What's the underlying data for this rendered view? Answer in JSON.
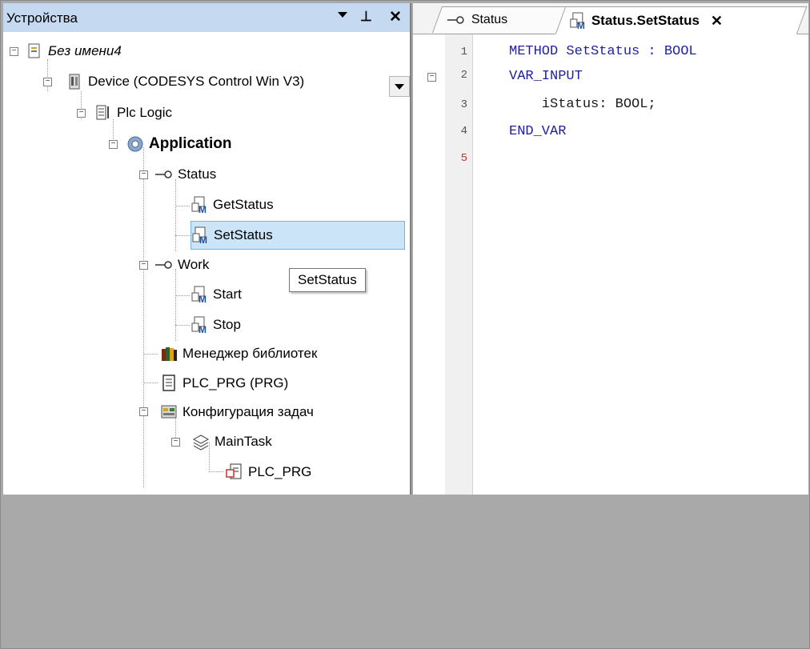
{
  "devices_panel": {
    "title": "Устройства",
    "tree": [
      {
        "label": "Без имени4",
        "italic": true
      },
      {
        "label": "Device (CODESYS Control Win V3)"
      },
      {
        "label": "Plc Logic"
      },
      {
        "label": "Application",
        "bold": true
      },
      {
        "label": "Status"
      },
      {
        "label": "GetStatus"
      },
      {
        "label": "SetStatus",
        "selected": true
      },
      {
        "label": "Work"
      },
      {
        "label": "Start"
      },
      {
        "label": "Stop"
      },
      {
        "label": "Менеджер библиотек"
      },
      {
        "label": "PLC_PRG (PRG)"
      },
      {
        "label": "Конфигурация задач"
      },
      {
        "label": "MainTask"
      },
      {
        "label": "PLC_PRG"
      }
    ],
    "tooltip": "SetStatus"
  },
  "editor": {
    "tabs": [
      {
        "label": "Status"
      },
      {
        "label": "Status.SetStatus",
        "active": true
      }
    ],
    "lines": [
      {
        "num": "1",
        "text": "METHOD SetStatus : BOOL"
      },
      {
        "num": "2",
        "text": "VAR_INPUT"
      },
      {
        "num": "3",
        "text": "    iStatus: BOOL;"
      },
      {
        "num": "4",
        "text": "END_VAR"
      },
      {
        "num": "5",
        "text": ""
      }
    ],
    "last_line_color": "#c0392b",
    "keyword_color": "#1f1f9f"
  },
  "colors": {
    "title_bar": "#c5d9f1",
    "selection": "#cce4f7",
    "background_gray": "#a9a9a9"
  }
}
